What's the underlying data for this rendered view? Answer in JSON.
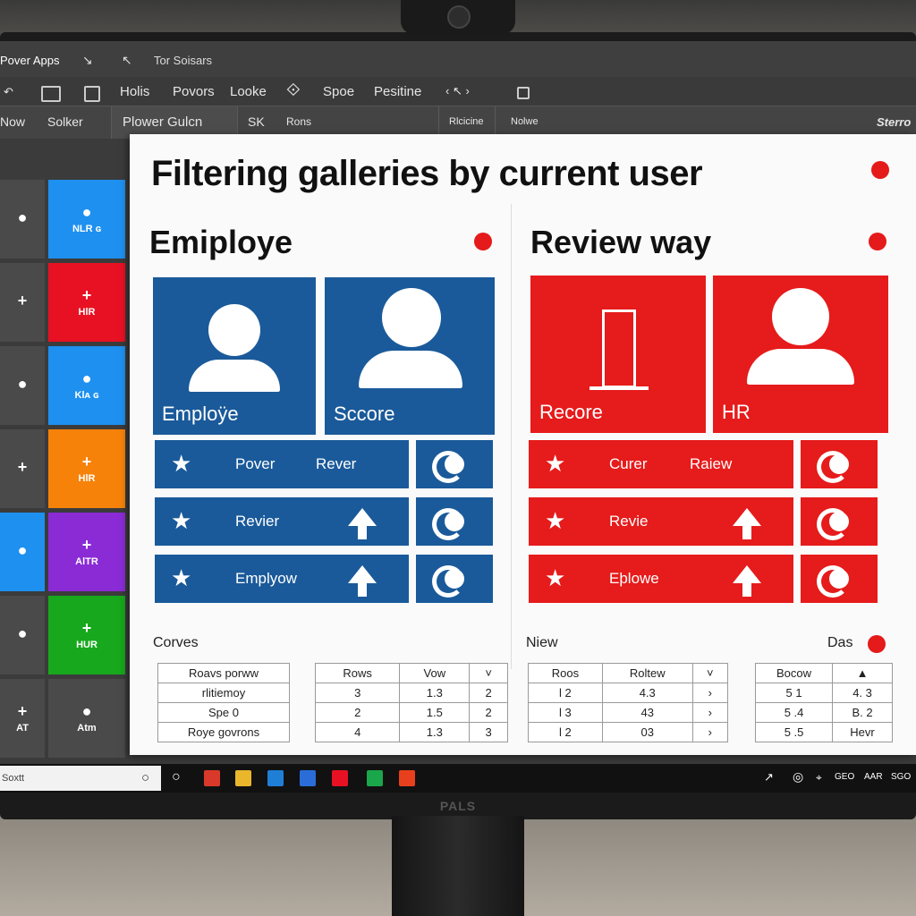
{
  "window": {
    "app_title": "Pover Apps",
    "doc_title": "Tor Soisars"
  },
  "ribbon": {
    "items": [
      "Holis",
      "Povors",
      "Looke",
      "Spoe",
      "Pesitine"
    ],
    "nav_glyph": "‹ ↖ ›"
  },
  "ribbon2": {
    "items": [
      "Now",
      "Solker",
      "Plower Gulcn",
      "SK",
      "Rons",
      "Rlcicine",
      "Nolwe"
    ],
    "right_text": "Sterro"
  },
  "left_tiles": [
    {
      "glyph": "●",
      "label": "",
      "color": "#4a4a4a"
    },
    {
      "glyph": "●",
      "label": "NLR ɢ",
      "color": "#1e90f0"
    },
    {
      "glyph": "+",
      "label": "",
      "color": "#4a4a4a"
    },
    {
      "glyph": "+",
      "label": "HlR",
      "color": "#e81123"
    },
    {
      "glyph": "●",
      "label": "",
      "color": "#4a4a4a"
    },
    {
      "glyph": "●",
      "label": "Klᴀ ɢ",
      "color": "#1e90f0"
    },
    {
      "glyph": "+",
      "label": "",
      "color": "#4a4a4a"
    },
    {
      "glyph": "+",
      "label": "HlR",
      "color": "#f7820a"
    },
    {
      "glyph": "●",
      "label": "",
      "color": "#1e90f0"
    },
    {
      "glyph": "+",
      "label": "AlTR",
      "color": "#8a2bd6"
    },
    {
      "glyph": "●",
      "label": "",
      "color": "#4a4a4a"
    },
    {
      "glyph": "+",
      "label": "HUR",
      "color": "#17a81d"
    },
    {
      "glyph": "+",
      "label": "AT",
      "color": "#4a4a4a"
    },
    {
      "glyph": "●",
      "label": "Atm",
      "color": "#4a4a4a"
    }
  ],
  "panel": {
    "title": "Filtering galleries by current user",
    "left_header": "Emiploye",
    "right_header": "Review way",
    "blue": "#1a5a9a",
    "red": "#e61b1b",
    "left_cards": [
      "Emploÿe",
      "Sccore"
    ],
    "right_cards": [
      "Recore",
      "HR"
    ],
    "left_rows": [
      {
        "t1": "Pover",
        "t2": "Rever"
      },
      {
        "t1": "Revier",
        "t2": ""
      },
      {
        "t1": "Emplyow",
        "t2": ""
      }
    ],
    "right_rows": [
      {
        "t1": "Curer",
        "t2": "Raiew"
      },
      {
        "t1": "Revie",
        "t2": ""
      },
      {
        "t1": "Eþlowe",
        "t2": ""
      }
    ],
    "section_labels": [
      "Corves",
      "Niew",
      "Das"
    ]
  },
  "tables": {
    "t1": [
      [
        "Roavs porww"
      ],
      [
        "rlitiemoy"
      ],
      [
        "Spe 0"
      ],
      [
        "Roye govrons"
      ]
    ],
    "t2": [
      [
        "Rows",
        "Vow",
        "˅"
      ],
      [
        "3",
        "1.3",
        "2"
      ],
      [
        "2",
        "1.5",
        "2"
      ],
      [
        "4",
        "1.3",
        "3"
      ]
    ],
    "t3": [
      [
        "Roos",
        "Roltew",
        "˅"
      ],
      [
        "l  2",
        "4.3",
        "›"
      ],
      [
        "l  3",
        "43",
        "›"
      ],
      [
        "l  2",
        "03",
        "›"
      ]
    ],
    "t4": [
      [
        "Bocow",
        "▲"
      ],
      [
        "5  1",
        "4. 3"
      ],
      [
        "5 .4",
        "B. 2"
      ],
      [
        "5 .5",
        "Hevr"
      ]
    ]
  },
  "taskbar": {
    "search_text": "Soxtt",
    "tray_items": [
      "GEO",
      "AAR",
      "SGO"
    ]
  },
  "monitor": {
    "brand": "PALS"
  }
}
